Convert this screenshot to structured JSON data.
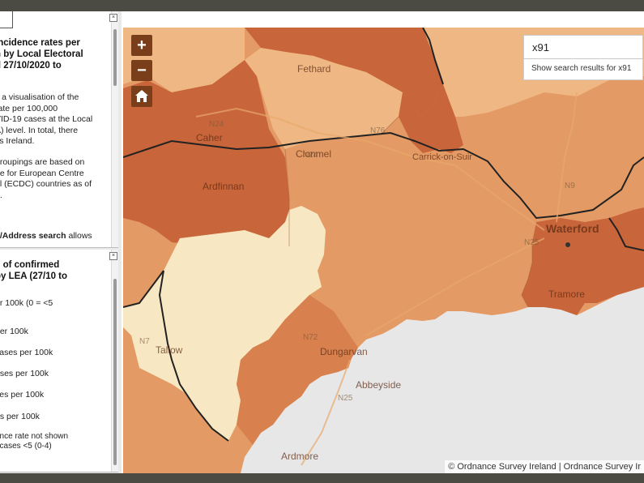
{
  "sidebar": {
    "panel1": {
      "title": "incidence rates per\nn by Local Electoral\nd 27/10/2020 to",
      "body": "s a visualisation of the\nrate per 100,000\nVID-19 cases at the Local\nA) level. In total, there\nss Ireland.",
      "body2": "groupings are based on\nge for European Centre\nol (ECDC) countries as of\n0.",
      "body3_bold": "e/Address search",
      "body3_rest": " allows"
    },
    "panel2": {
      "title": "e of confirmed\n by LEA (27/10 to",
      "legend": [
        {
          "label": "er 100k (0 = <5"
        },
        {
          "label": "per 100k"
        },
        {
          "label": "cases per 100k"
        },
        {
          "label": "ases per 100k"
        },
        {
          "label": "ses per 100k"
        },
        {
          "label": "es per 100k"
        }
      ],
      "note": "ence rate not shown\nf cases <5 (0-4)"
    }
  },
  "map": {
    "controls": {
      "zoom_in": "+",
      "zoom_out": "−",
      "home_icon": "home-icon"
    },
    "search": {
      "value": "x91",
      "suggestion": "Show search results for x91"
    },
    "places": {
      "fethard": "Fethard",
      "caher": "Caher",
      "ardfinnan": "Ardfinnan",
      "clonmel": "Clonmel",
      "carrick": "Carrick-on-Suir",
      "waterford": "Waterford",
      "tramore": "Tramore",
      "dungarvan": "Dungarvan",
      "abbeyside": "Abbeyside",
      "ardmore": "Ardmore",
      "tallow": "Tallow"
    },
    "roads": {
      "n24a": "N24",
      "n24b": "N24",
      "n76": "N76",
      "n9": "N9",
      "n25a": "N25",
      "n25b": "N25",
      "n72": "N72",
      "n72b": "N7"
    },
    "attribution": "© Ordnance Survey Ireland | Ordnance Survey Ir"
  },
  "colors": {
    "class_high": "#c8653a",
    "class_midhigh": "#d8804e",
    "class_mid": "#e39a64",
    "class_light": "#efb783",
    "class_lowest": "#f7e7c2",
    "sea": "#e7e7e7",
    "control_bg": "#7a3e1b"
  }
}
